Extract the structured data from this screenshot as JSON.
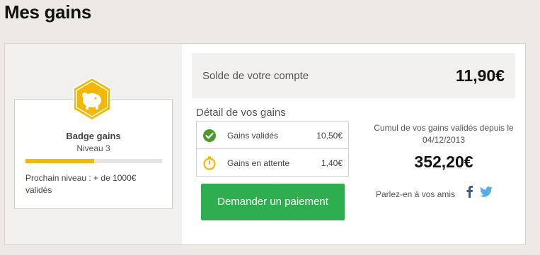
{
  "page": {
    "title": "Mes gains"
  },
  "badge": {
    "title": "Badge gains",
    "level": "Niveau 3",
    "progress_percent": 50,
    "next_level": "Prochain niveau : + de 1000€ validés"
  },
  "balance": {
    "label": "Solde de votre compte",
    "amount": "11,90€"
  },
  "details": {
    "title": "Détail de vos gains",
    "rows": [
      {
        "label": "Gains validés",
        "value": "10,50€",
        "icon": "check-circle-icon",
        "color": "#4c9a2a"
      },
      {
        "label": "Gains en attente",
        "value": "1,40€",
        "icon": "stopwatch-icon",
        "color": "#f5b800"
      }
    ]
  },
  "pay_button": {
    "label": "Demander un paiement",
    "color": "#2fae4f"
  },
  "cumul": {
    "label": "Cumul de vos gains validés depuis le 04/12/2013",
    "amount": "352,20€"
  },
  "share": {
    "text": "Parlez-en à vos amis",
    "icons": [
      "facebook-icon",
      "twitter-icon"
    ]
  },
  "colors": {
    "accent_yellow": "#f5b800",
    "facebook": "#3b5998",
    "twitter": "#55acee"
  }
}
